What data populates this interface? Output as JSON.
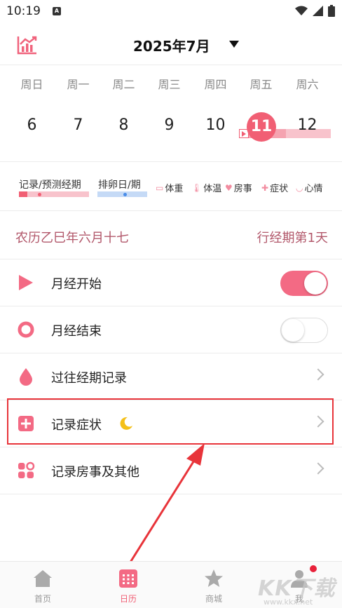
{
  "status_bar": {
    "time": "10:19",
    "notif_letter": "A"
  },
  "header": {
    "month_title": "2025年7月"
  },
  "week": {
    "weekdays": [
      "周日",
      "周一",
      "周二",
      "周三",
      "周四",
      "周五",
      "周六"
    ],
    "days": [
      "6",
      "7",
      "8",
      "9",
      "10",
      "11",
      "12"
    ],
    "today": "11"
  },
  "legend": {
    "period_label": "记录/预测经期",
    "ovulation_label": "排卵日/期",
    "items": [
      "体重",
      "体温",
      "房事",
      "症状",
      "心情"
    ]
  },
  "info": {
    "lunar": "农历乙巳年六月十七",
    "phase": "行经期第1天"
  },
  "rows": [
    {
      "label": "月经开始",
      "control": "toggle",
      "state": "on"
    },
    {
      "label": "月经结束",
      "control": "toggle",
      "state": "off"
    },
    {
      "label": "过往经期记录",
      "control": "chevron"
    },
    {
      "label": "记录症状",
      "control": "chevron"
    },
    {
      "label": "记录房事及其他",
      "control": "chevron"
    }
  ],
  "bottom_nav": [
    "首页",
    "日历",
    "商城",
    "我"
  ],
  "watermark": {
    "big": "KK下载",
    "small": "www.kkx.net"
  },
  "colors": {
    "accent": "#f15f74",
    "period": "#f5a3b0",
    "ovulation": "#a9c8f2",
    "annotation": "#e8343a"
  }
}
